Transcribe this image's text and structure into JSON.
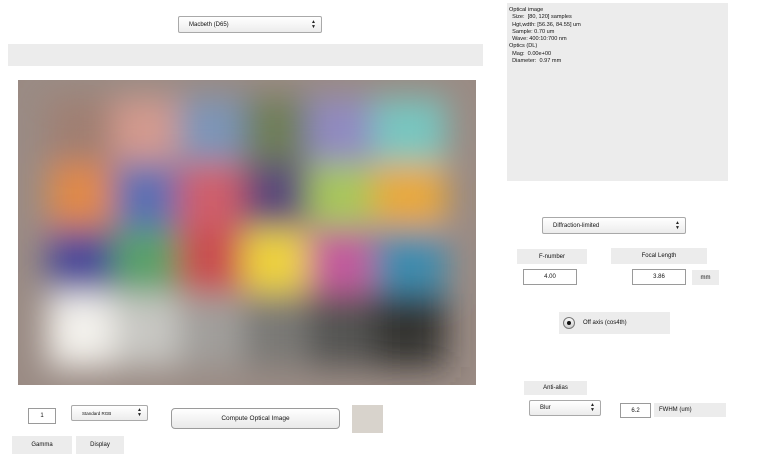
{
  "scene_selector": {
    "value": "Macbeth (D65)"
  },
  "optics_info": {
    "lines": [
      "Optical image",
      "  Size:  [80, 120] samples",
      "  Hgt,wdth: [56.36, 84.55] um",
      "  Sample: 0.70 um",
      "  Wave: 400:10:700 nm",
      "Optics (DL)",
      "  Mag:  0.00e+00",
      "  Diameter:  0.97 mm"
    ]
  },
  "optics_model": {
    "value": "Diffraction-limited"
  },
  "fnumber": {
    "label": "F-number",
    "value": "4.00"
  },
  "focal_length": {
    "label": "Focal Length",
    "value": "3.86",
    "unit": "mm"
  },
  "off_axis": {
    "label": "Off axis (cos4th)",
    "selected": true
  },
  "anti_alias": {
    "label": "Anti-alias",
    "method": "Blur",
    "fwhm_value": "6.2",
    "fwhm_label": "FWHM (um)"
  },
  "display": {
    "gamma_value": "1",
    "display_mode": "Standard RGB",
    "gamma_label": "Gamma",
    "display_label": "Display"
  },
  "compute_button": {
    "label": "Compute Optical Image"
  },
  "colors": {
    "panel_gray": "#ececec",
    "image_border": "#9a8b84",
    "swatch": "#d8d3cc"
  },
  "image_patches": [
    [
      "#a07f72",
      "#d39a8e",
      "#7d95b8",
      "#6f7e58",
      "#918ac1",
      "#78c6c0"
    ],
    [
      "#e0894a",
      "#5c6fb3",
      "#cf5e6b",
      "#5c4a7a",
      "#a8c65c",
      "#e8a93c"
    ],
    [
      "#4e4c9a",
      "#5aa06a",
      "#c94e50",
      "#edd23e",
      "#c25a9c",
      "#3f8cae"
    ],
    [
      "#f3f1ec",
      "#c8c7c3",
      "#a19f9b",
      "#7a7976",
      "#555452",
      "#353433"
    ]
  ]
}
